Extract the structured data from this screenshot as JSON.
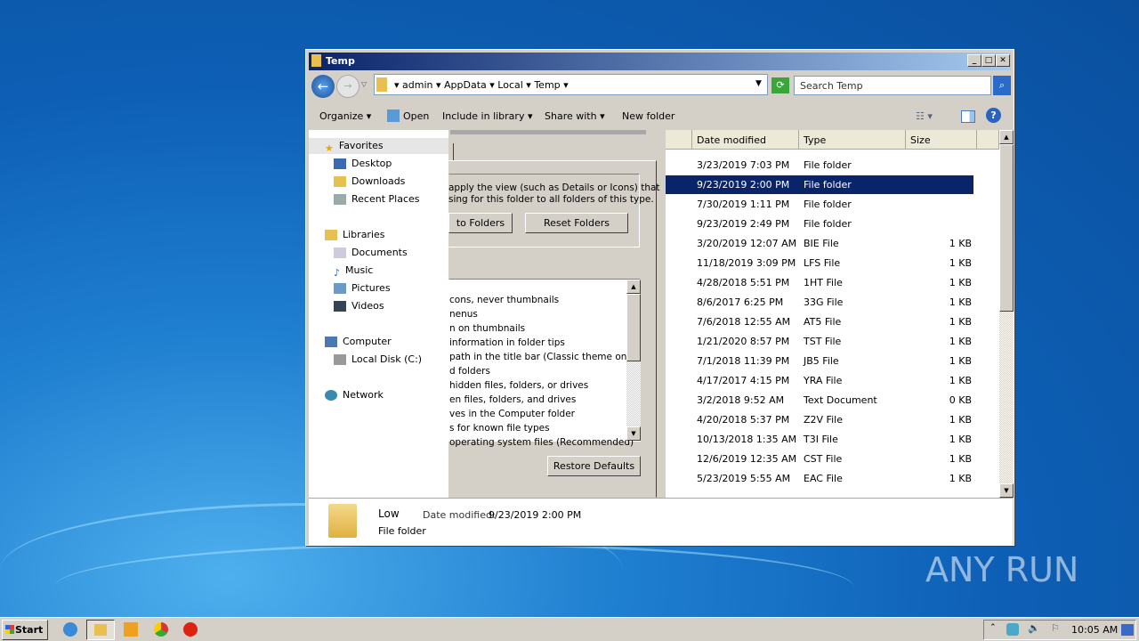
{
  "window": {
    "title": "Temp",
    "minimize": "_",
    "maximize": "□",
    "close": "✕"
  },
  "address": {
    "crumbs": [
      "admin",
      "AppData",
      "Local",
      "Temp"
    ],
    "search_placeholder": "Search Temp"
  },
  "toolbar": {
    "organize": "Organize",
    "open": "Open",
    "include": "Include in library",
    "share": "Share with",
    "new_folder": "New folder"
  },
  "nav": {
    "favorites": "Favorites",
    "desktop": "Desktop",
    "downloads": "Downloads",
    "recent": "Recent Places",
    "libraries": "Libraries",
    "documents": "Documents",
    "music": "Music",
    "pictures": "Pictures",
    "videos": "Videos",
    "computer": "Computer",
    "local_disk": "Local Disk (C:)",
    "network": "Network"
  },
  "dialog": {
    "desc1": "apply the view (such as Details or Icons) that",
    "desc2": "sing for this folder to all folders of this type.",
    "apply": "to Folders",
    "reset": "Reset Folders",
    "restore": "Restore Defaults",
    "settings": [
      "cons, never thumbnails",
      "nenus",
      "n on thumbnails",
      " information in folder tips",
      "path in the title bar (Classic theme only)",
      "d folders",
      " hidden files, folders, or drives",
      "en files, folders, and drives",
      "ves in the Computer folder",
      "s for known file types",
      " operating system files (Recommended)"
    ]
  },
  "columns": {
    "date": "Date modified",
    "type": "Type",
    "size": "Size"
  },
  "files": [
    {
      "date": "3/23/2019 7:03 PM",
      "type": "File folder",
      "size": ""
    },
    {
      "date": "9/23/2019 2:00 PM",
      "type": "File folder",
      "size": ""
    },
    {
      "date": "7/30/2019 1:11 PM",
      "type": "File folder",
      "size": ""
    },
    {
      "date": "9/23/2019 2:49 PM",
      "type": "File folder",
      "size": ""
    },
    {
      "date": "3/20/2019 12:07 AM",
      "type": "BIE File",
      "size": "1 KB"
    },
    {
      "date": "11/18/2019 3:09 PM",
      "type": "LFS File",
      "size": "1 KB"
    },
    {
      "date": "4/28/2018 5:51 PM",
      "type": "1HT File",
      "size": "1 KB"
    },
    {
      "date": "8/6/2017 6:25 PM",
      "type": "33G File",
      "size": "1 KB"
    },
    {
      "date": "7/6/2018 12:55 AM",
      "type": "AT5 File",
      "size": "1 KB"
    },
    {
      "date": "1/21/2020 8:57 PM",
      "type": "TST File",
      "size": "1 KB"
    },
    {
      "date": "7/1/2018 11:39 PM",
      "type": "JB5 File",
      "size": "1 KB"
    },
    {
      "date": "4/17/2017 4:15 PM",
      "type": "YRA File",
      "size": "1 KB"
    },
    {
      "date": "3/2/2018 9:52 AM",
      "type": "Text Document",
      "size": "0 KB"
    },
    {
      "date": "4/20/2018 5:37 PM",
      "type": "Z2V File",
      "size": "1 KB"
    },
    {
      "date": "10/13/2018 1:35 AM",
      "type": "T3I File",
      "size": "1 KB"
    },
    {
      "date": "12/6/2019 12:35 AM",
      "type": "CST File",
      "size": "1 KB"
    },
    {
      "date": "5/23/2019 5:55 AM",
      "type": "EAC File",
      "size": "1 KB"
    }
  ],
  "selected_index": 1,
  "details": {
    "name": "Low",
    "date_label": "Date modified:",
    "date": "9/23/2019 2:00 PM",
    "type": "File folder"
  },
  "taskbar": {
    "start": "Start",
    "clock": "10:05 AM"
  },
  "watermark": "ANY RUN"
}
